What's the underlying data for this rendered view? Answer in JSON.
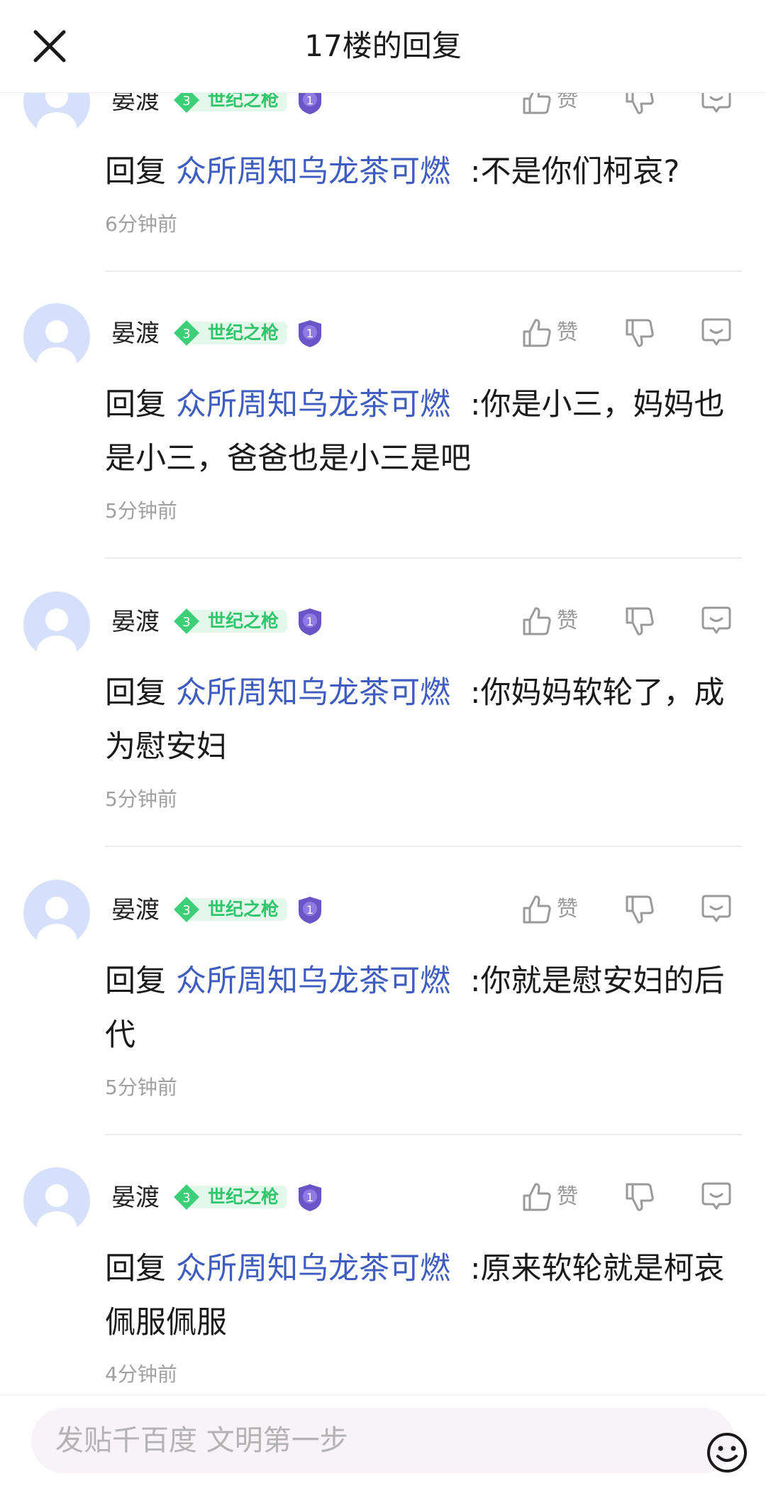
{
  "header": {
    "title": "17楼的回复",
    "close_icon": "close-icon"
  },
  "replies": [
    {
      "username": "晏渡",
      "badge_level": "3",
      "badge_text": "世纪之枪",
      "rank": "1",
      "like_label": "赞",
      "reply_prefix": "回复",
      "reply_target": "众所周知乌龙茶可燃",
      "content": ":不是你们柯哀?",
      "time": "6分钟前"
    },
    {
      "username": "晏渡",
      "badge_level": "3",
      "badge_text": "世纪之枪",
      "rank": "1",
      "like_label": "赞",
      "reply_prefix": "回复",
      "reply_target": "众所周知乌龙茶可燃",
      "content": ":你是小三，妈妈也是小三，爸爸也是小三是吧",
      "time": "5分钟前"
    },
    {
      "username": "晏渡",
      "badge_level": "3",
      "badge_text": "世纪之枪",
      "rank": "1",
      "like_label": "赞",
      "reply_prefix": "回复",
      "reply_target": "众所周知乌龙茶可燃",
      "content": ":你妈妈软轮了，成为慰安妇",
      "time": "5分钟前"
    },
    {
      "username": "晏渡",
      "badge_level": "3",
      "badge_text": "世纪之枪",
      "rank": "1",
      "like_label": "赞",
      "reply_prefix": "回复",
      "reply_target": "众所周知乌龙茶可燃",
      "content": ":你就是慰安妇的后代",
      "time": "5分钟前"
    },
    {
      "username": "晏渡",
      "badge_level": "3",
      "badge_text": "世纪之枪",
      "rank": "1",
      "like_label": "赞",
      "reply_prefix": "回复",
      "reply_target": "众所周知乌龙茶可燃",
      "content": ":原来软轮就是柯哀佩服佩服",
      "time": "4分钟前"
    }
  ],
  "bottom_bar": {
    "input_placeholder": "发贴千百度 文明第一步",
    "emoji_icon": "smiley-icon"
  },
  "colors": {
    "link": "#3f5dbf",
    "badge_green": "#2fc56b",
    "badge_bg": "#e3f7ea",
    "avatar_bg": "#d7e0fa",
    "muted": "#a0a0a0"
  }
}
